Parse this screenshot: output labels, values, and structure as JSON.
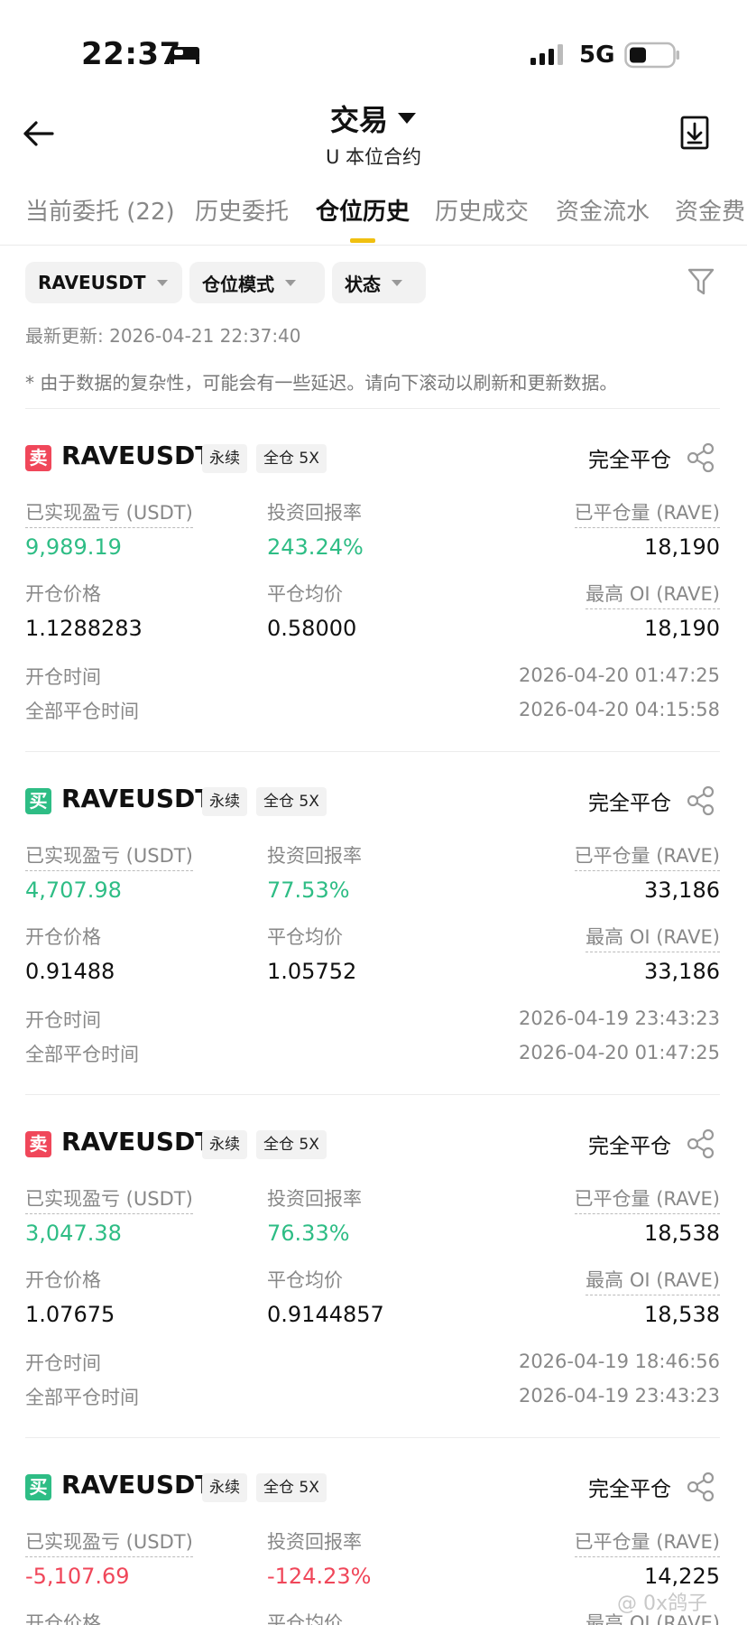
{
  "status_bar": {
    "time": "22:37",
    "network": "5G"
  },
  "header": {
    "title": "交易",
    "subtitle": "U 本位合约"
  },
  "tabs": [
    {
      "label": "当前委托 (22)"
    },
    {
      "label": "历史委托"
    },
    {
      "label": "仓位历史"
    },
    {
      "label": "历史成交"
    },
    {
      "label": "资金流水"
    },
    {
      "label": "资金费"
    }
  ],
  "active_tab": "仓位历史",
  "filters": {
    "symbol": "RAVEUSDT",
    "mode": "仓位模式",
    "status": "状态"
  },
  "updated": "最新更新: 2026-04-21 22:37:40",
  "notice": "* 由于数据的复杂性，可能会有一些延迟。请向下滚动以刷新和更新数据。",
  "labels": {
    "pnl": "已实现盈亏 (USDT)",
    "roi": "投资回报率",
    "closed_qty": "已平仓量 (RAVE)",
    "open_price": "开仓价格",
    "close_avg": "平仓均价",
    "max_oi": "最高 OI (RAVE)",
    "open_time": "开仓时间",
    "close_time": "全部平仓时间"
  },
  "colors": {
    "profit": "#2ebd85",
    "loss": "#f0475a",
    "accent": "#f0c010"
  },
  "positions": [
    {
      "side": "卖",
      "symbol": "RAVEUSDT",
      "tag1": "永续",
      "tag2": "全仓 5X",
      "status": "完全平仓",
      "pnl": "9,989.19",
      "roi": "243.24%",
      "closed_qty": "18,190",
      "open_price": "1.1288283",
      "close_avg": "0.58000",
      "max_oi": "18,190",
      "open_time": "2026-04-20 01:47:25",
      "close_time": "2026-04-20 04:15:58"
    },
    {
      "side": "买",
      "symbol": "RAVEUSDT",
      "tag1": "永续",
      "tag2": "全仓 5X",
      "status": "完全平仓",
      "pnl": "4,707.98",
      "roi": "77.53%",
      "closed_qty": "33,186",
      "open_price": "0.91488",
      "close_avg": "1.05752",
      "max_oi": "33,186",
      "open_time": "2026-04-19 23:43:23",
      "close_time": "2026-04-20 01:47:25"
    },
    {
      "side": "卖",
      "symbol": "RAVEUSDT",
      "tag1": "永续",
      "tag2": "全仓 5X",
      "status": "完全平仓",
      "pnl": "3,047.38",
      "roi": "76.33%",
      "closed_qty": "18,538",
      "open_price": "1.07675",
      "close_avg": "0.9144857",
      "max_oi": "18,538",
      "open_time": "2026-04-19 18:46:56",
      "close_time": "2026-04-19 23:43:23"
    },
    {
      "side": "买",
      "symbol": "RAVEUSDT",
      "tag1": "永续",
      "tag2": "全仓 5X",
      "status": "完全平仓",
      "pnl": "-5,107.69",
      "roi": "-124.23%",
      "closed_qty": "14,225"
    }
  ],
  "watermark": "@ 0x鸽子"
}
